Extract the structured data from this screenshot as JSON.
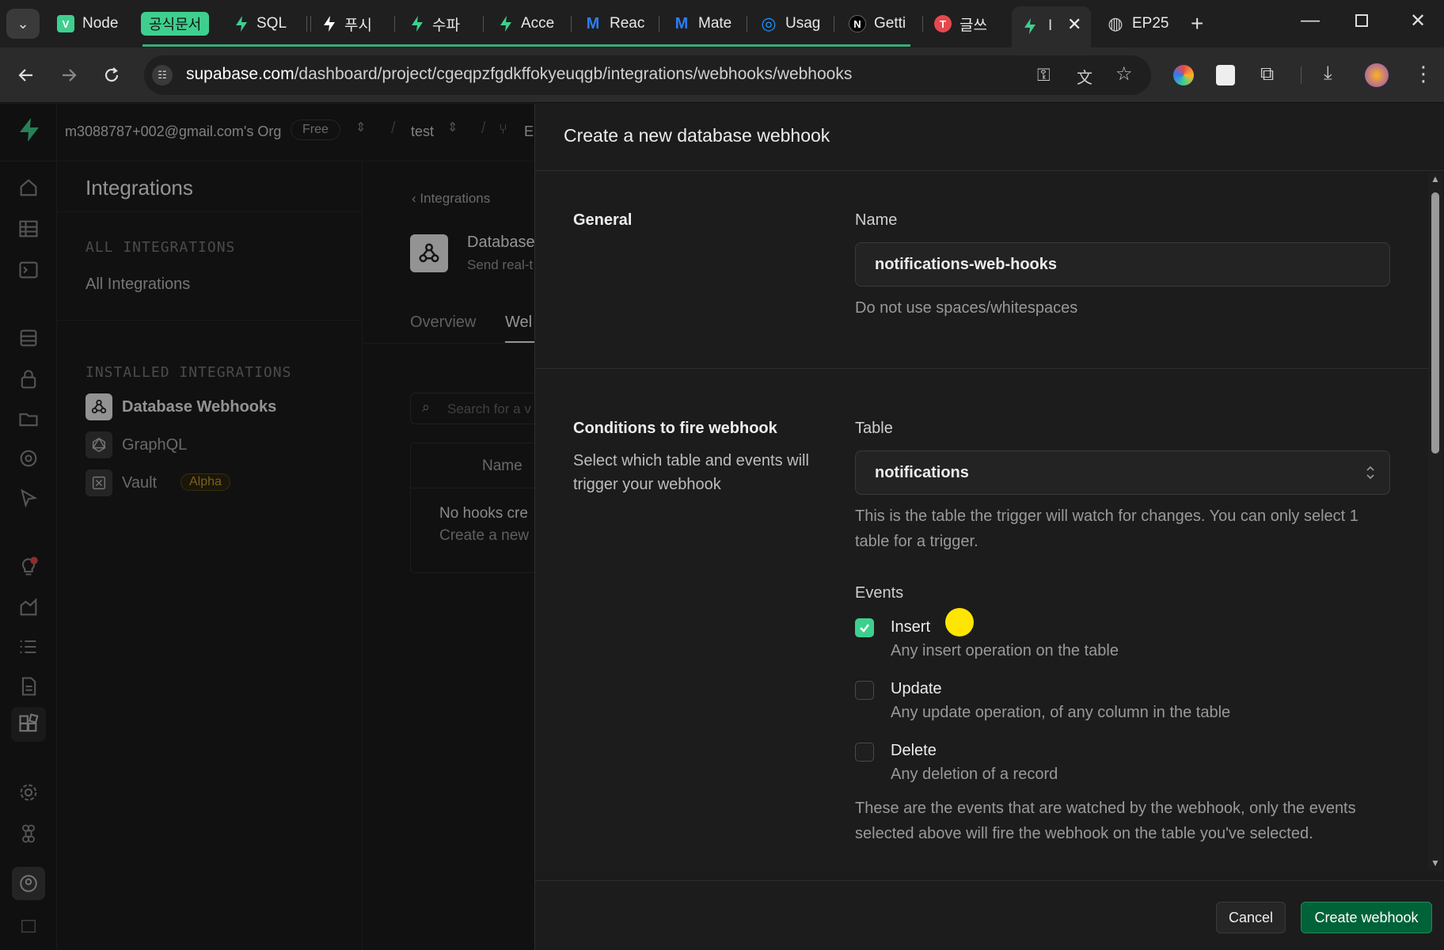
{
  "browser": {
    "tabs": [
      {
        "label": "Node",
        "fav_text": "V",
        "fav_bg": "#3ecf8e",
        "fav_color": "#ffffff"
      },
      {
        "label": "공식문서",
        "highlight": true
      },
      {
        "label": "SQL",
        "fav_bolt": "#3ecf8e"
      },
      {
        "label": "푸시",
        "fav_bolt": "#ffffff"
      },
      {
        "label": "수파",
        "fav_bolt": "#3ecf8e"
      },
      {
        "label": "Acce",
        "fav_bolt": "#3ecf8e"
      },
      {
        "label": "Reac",
        "fav_text": "M",
        "fav_color": "#2f7bf5"
      },
      {
        "label": "Mate",
        "fav_text": "M",
        "fav_color": "#2f7bf5"
      },
      {
        "label": "Usag",
        "fav_text": "◎",
        "fav_color": "#1e90ff"
      },
      {
        "label": "Getti",
        "fav_text": "N",
        "fav_bg": "#000000",
        "fav_color": "#ffffff"
      },
      {
        "label": "글쓰",
        "fav_text": "T",
        "fav_bg": "#e5484d",
        "fav_color": "#ffffff"
      },
      {
        "label": "I",
        "fav_bolt": "#3ecf8e",
        "active": true
      },
      {
        "label": "EP25",
        "fav_text": "◍",
        "fav_color": "#cccccc"
      }
    ],
    "url_host": "supabase.com",
    "url_path": "/dashboard/project/cgeqpzfgdkffokyeuqgb/integrations/webhooks/webhooks"
  },
  "header": {
    "org_name": "m3088787+002@gmail.com's Org",
    "plan_badge": "Free",
    "project": "test",
    "branch_initial": "E"
  },
  "sidebar": {
    "title": "Integrations",
    "all_heading": "ALL INTEGRATIONS",
    "all_link": "All Integrations",
    "installed_heading": "INSTALLED INTEGRATIONS",
    "items": [
      {
        "label": "Database Webhooks"
      },
      {
        "label": "GraphQL"
      },
      {
        "label": "Vault",
        "badge": "Alpha"
      }
    ]
  },
  "main": {
    "breadcrumb": "Integrations",
    "page_title": "Database",
    "page_subtitle": "Send real-t",
    "tabs": [
      "Overview",
      "Wel"
    ],
    "search_placeholder": "Search for a v",
    "table_header": "Name",
    "empty_line1": "No hooks cre",
    "empty_line2": "Create a new"
  },
  "drawer": {
    "title": "Create a new database webhook",
    "general": {
      "section": "General",
      "name_label": "Name",
      "name_value": "notifications-web-hooks",
      "name_help": "Do not use spaces/whitespaces"
    },
    "conditions": {
      "section": "Conditions to fire webhook",
      "section_desc_1": "Select which table and events will",
      "section_desc_2": "trigger your webhook",
      "table_label": "Table",
      "table_value": "notifications",
      "table_help_1": "This is the table the trigger will watch for changes. You can only select 1",
      "table_help_2": "table for a trigger.",
      "events_label": "Events",
      "events": [
        {
          "label": "Insert",
          "desc": "Any insert operation on the table",
          "checked": true
        },
        {
          "label": "Update",
          "desc": "Any update operation, of any column in the table",
          "checked": false
        },
        {
          "label": "Delete",
          "desc": "Any deletion of a record",
          "checked": false
        }
      ],
      "events_help_1": "These are the events that are watched by the webhook, only the events",
      "events_help_2": "selected above will fire the webhook on the table you've selected."
    },
    "cancel_label": "Cancel",
    "create_label": "Create webhook"
  },
  "colors": {
    "accent": "#3ecf8e",
    "primary_button": "#006239",
    "cursor_marker": "#ffe600"
  }
}
